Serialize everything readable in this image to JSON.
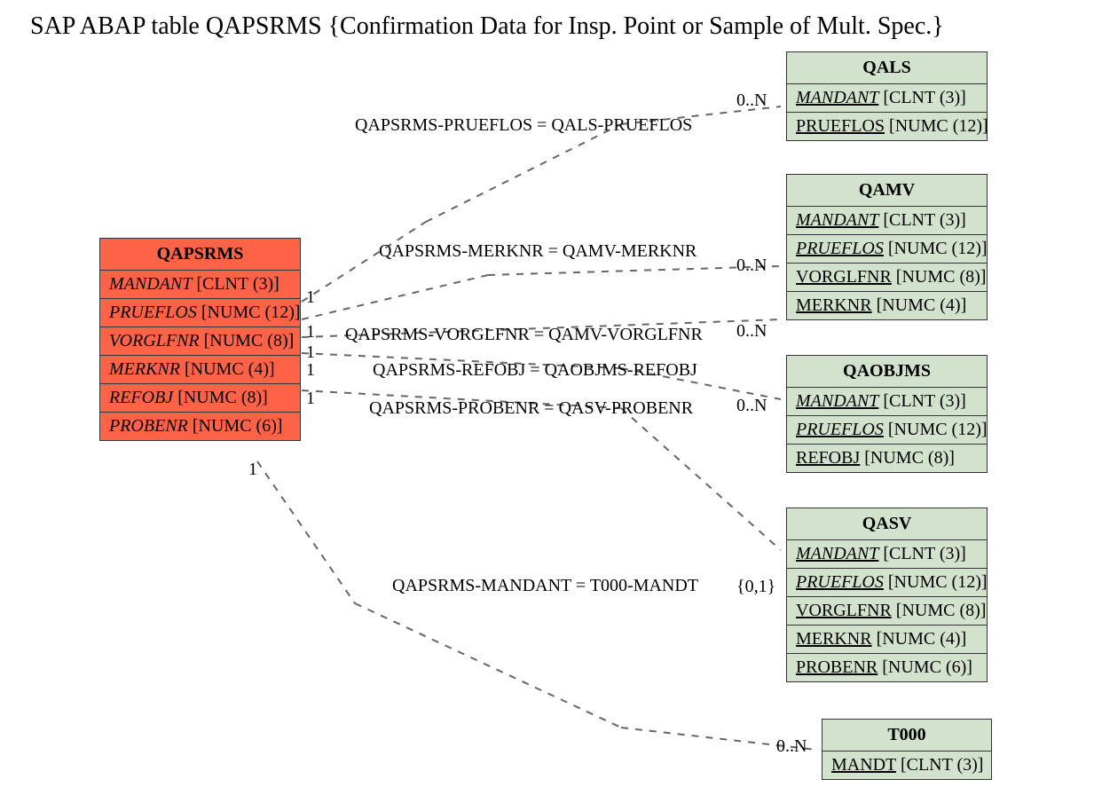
{
  "title": "SAP ABAP table QAPSRMS {Confirmation Data for Insp. Point or Sample of Mult. Spec.}",
  "main": {
    "name": "QAPSRMS",
    "fields": [
      {
        "fname": "MANDANT",
        "ftype": "[CLNT (3)]"
      },
      {
        "fname": "PRUEFLOS",
        "ftype": "[NUMC (12)]"
      },
      {
        "fname": "VORGLFNR",
        "ftype": "[NUMC (8)]"
      },
      {
        "fname": "MERKNR",
        "ftype": "[NUMC (4)]"
      },
      {
        "fname": "REFOBJ",
        "ftype": "[NUMC (8)]"
      },
      {
        "fname": "PROBENR",
        "ftype": "[NUMC (6)]"
      }
    ]
  },
  "related": {
    "qals": {
      "name": "QALS",
      "fields": [
        {
          "fname": "MANDANT",
          "ftype": "[CLNT (3)]",
          "style": "iu"
        },
        {
          "fname": "PRUEFLOS",
          "ftype": "[NUMC (12)]",
          "style": "u"
        }
      ]
    },
    "qamv": {
      "name": "QAMV",
      "fields": [
        {
          "fname": "MANDANT",
          "ftype": "[CLNT (3)]",
          "style": "iu"
        },
        {
          "fname": "PRUEFLOS",
          "ftype": "[NUMC (12)]",
          "style": "iu"
        },
        {
          "fname": "VORGLFNR",
          "ftype": "[NUMC (8)]",
          "style": "u"
        },
        {
          "fname": "MERKNR",
          "ftype": "[NUMC (4)]",
          "style": "u"
        }
      ]
    },
    "qaobjms": {
      "name": "QAOBJMS",
      "fields": [
        {
          "fname": "MANDANT",
          "ftype": "[CLNT (3)]",
          "style": "iu"
        },
        {
          "fname": "PRUEFLOS",
          "ftype": "[NUMC (12)]",
          "style": "iu"
        },
        {
          "fname": "REFOBJ",
          "ftype": "[NUMC (8)]",
          "style": "u"
        }
      ]
    },
    "qasv": {
      "name": "QASV",
      "fields": [
        {
          "fname": "MANDANT",
          "ftype": "[CLNT (3)]",
          "style": "iu"
        },
        {
          "fname": "PRUEFLOS",
          "ftype": "[NUMC (12)]",
          "style": "iu"
        },
        {
          "fname": "VORGLFNR",
          "ftype": "[NUMC (8)]",
          "style": "u"
        },
        {
          "fname": "MERKNR",
          "ftype": "[NUMC (4)]",
          "style": "u"
        },
        {
          "fname": "PROBENR",
          "ftype": "[NUMC (6)]",
          "style": "u"
        }
      ]
    },
    "t000": {
      "name": "T000",
      "fields": [
        {
          "fname": "MANDT",
          "ftype": "[CLNT (3)]",
          "style": "u"
        }
      ]
    }
  },
  "relations": {
    "r1": "QAPSRMS-PRUEFLOS = QALS-PRUEFLOS",
    "r2": "QAPSRMS-MERKNR = QAMV-MERKNR",
    "r3": "QAPSRMS-VORGLFNR = QAMV-VORGLFNR",
    "r4": "QAPSRMS-REFOBJ = QAOBJMS-REFOBJ",
    "r5": "QAPSRMS-PROBENR = QASV-PROBENR",
    "r6": "QAPSRMS-MANDANT = T000-MANDT"
  },
  "card": {
    "one": "1",
    "zn": "0..N",
    "z1": "{0,1}"
  }
}
